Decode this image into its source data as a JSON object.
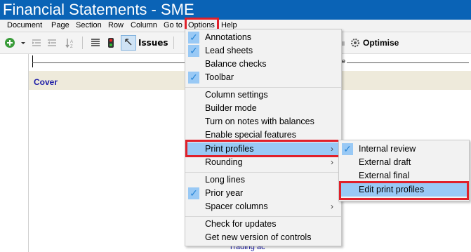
{
  "window": {
    "title": "Financial Statements - SME"
  },
  "menubar": {
    "items": [
      "Document",
      "Page",
      "Section",
      "Row",
      "Column",
      "Go to",
      "Options",
      "Help"
    ]
  },
  "toolbar": {
    "issues_label": "Issues",
    "optimise_label": "Optimise"
  },
  "document": {
    "cover_label": "Cover",
    "ruler_fragment": "ge",
    "footer_fragment": "Trading ac"
  },
  "options_menu": {
    "items": [
      {
        "label": "Annotations",
        "checked": true
      },
      {
        "label": "Lead sheets",
        "checked": true
      },
      {
        "label": "Balance checks",
        "checked": false
      },
      {
        "label": "Toolbar",
        "checked": true
      },
      {
        "label": "Column settings",
        "checked": false
      },
      {
        "label": "Builder mode",
        "checked": false
      },
      {
        "label": "Turn on notes with balances",
        "checked": false
      },
      {
        "label": "Enable special features",
        "checked": false
      },
      {
        "label": "Print profiles",
        "checked": false,
        "submenu": true,
        "highlighted": true
      },
      {
        "label": "Rounding",
        "checked": false,
        "submenu": true
      },
      {
        "label": "Long lines",
        "checked": false
      },
      {
        "label": "Prior year",
        "checked": true
      },
      {
        "label": "Spacer columns",
        "checked": false,
        "submenu": true
      },
      {
        "label": "Check for updates",
        "checked": false
      },
      {
        "label": "Get new version of controls",
        "checked": false
      }
    ]
  },
  "print_profiles_menu": {
    "items": [
      {
        "label": "Internal review",
        "checked": true
      },
      {
        "label": "External draft",
        "checked": false
      },
      {
        "label": "External final",
        "checked": false
      },
      {
        "label": "Edit print profiles",
        "checked": false,
        "highlighted": true
      }
    ]
  },
  "colors": {
    "title_bar": "#0a63b6",
    "highlight": "#99c9f5",
    "callout": "#e0202a",
    "check": "#2b88d8"
  }
}
